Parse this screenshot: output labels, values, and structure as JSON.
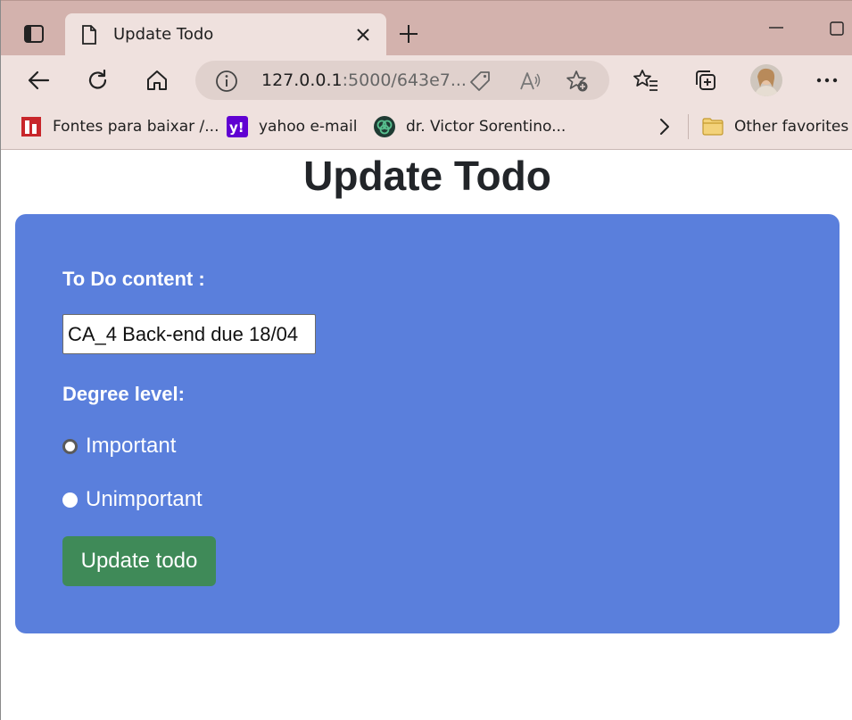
{
  "browser": {
    "tab": {
      "title": "Update Todo"
    },
    "address": {
      "host": "127.0.0.1",
      "rest": ":5000/643e7..."
    },
    "favorites": [
      {
        "label": "Fontes para baixar /...",
        "icon": "fontes-favicon"
      },
      {
        "label": "yahoo e-mail",
        "icon": "yahoo-favicon"
      },
      {
        "label": "dr. Victor Sorentino...",
        "icon": "sorentino-favicon"
      }
    ],
    "other_favorites": "Other favorites"
  },
  "page": {
    "title": "Update Todo",
    "form": {
      "content_label": "To Do content :",
      "content_value": "CA_4 Back-end due 18/04",
      "degree_label": "Degree level:",
      "options": [
        {
          "label": "Important",
          "checked": false
        },
        {
          "label": "Unimportant",
          "checked": false
        }
      ],
      "submit_label": "Update todo"
    }
  },
  "colors": {
    "card": "#5a7fdc",
    "submit": "#3f8a58",
    "tabstrip": "#d3b2ad",
    "toolbar": "#efe1de"
  }
}
